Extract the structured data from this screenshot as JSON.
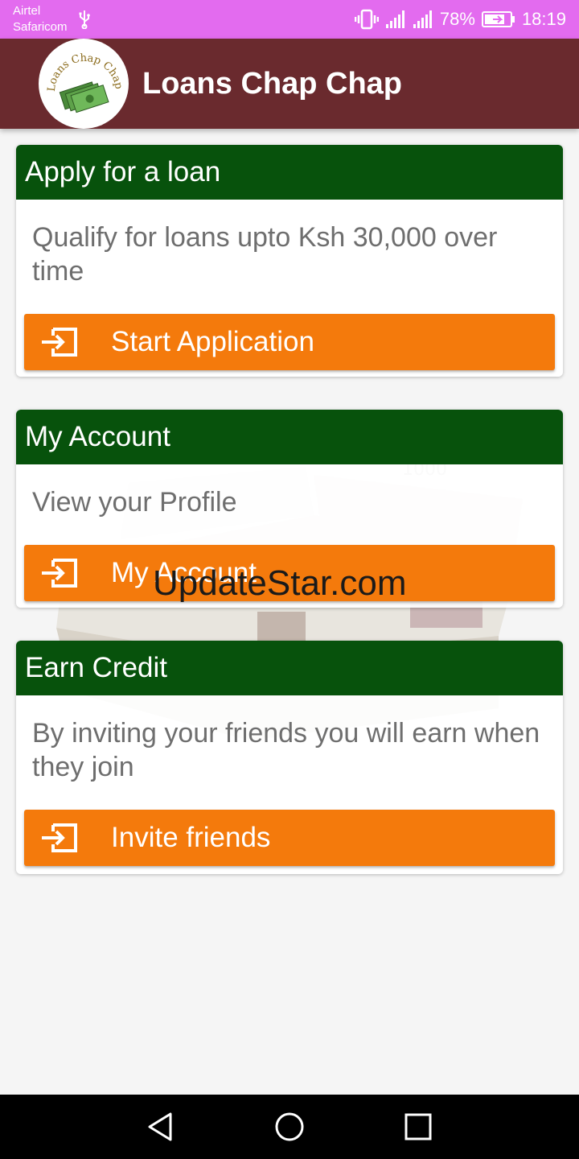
{
  "status_bar": {
    "carrier_1": "Airtel",
    "carrier_2": "Safaricom",
    "battery_percent": "78%",
    "time": "18:19",
    "icons": [
      "usb-icon",
      "vibrate-icon",
      "signal-icon",
      "signal-icon",
      "battery-charging-icon"
    ]
  },
  "app_bar": {
    "title": "Loans Chap Chap",
    "logo_text": "Loans Chap Chap"
  },
  "cards": [
    {
      "header": "Apply for a loan",
      "body": "Qualify for loans upto Ksh 30,000 over time",
      "button_label": "Start Application",
      "button_icon": "exit-to-app-icon"
    },
    {
      "header": "My Account",
      "body": "View your Profile",
      "button_label": "My Account",
      "button_icon": "exit-to-app-icon"
    },
    {
      "header": "Earn Credit",
      "body": "By inviting your friends you will earn when they join",
      "button_label": "Invite friends",
      "button_icon": "exit-to-app-icon"
    }
  ],
  "watermark": "UpdateStar.com",
  "nav_bar": {
    "buttons": [
      "back-icon",
      "home-icon",
      "recents-icon"
    ]
  },
  "colors": {
    "status_bar": "#e36bef",
    "app_bar": "#6a2a2e",
    "card_header": "#07520c",
    "button": "#f47a0c"
  }
}
